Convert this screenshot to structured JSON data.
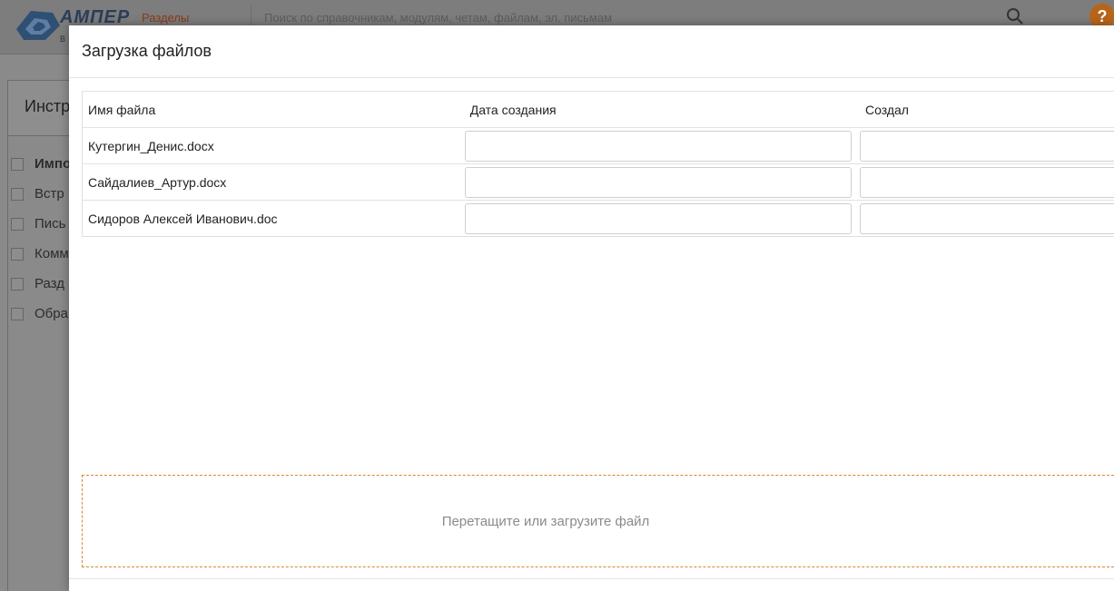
{
  "app": {
    "logo_text": "АМПЕР",
    "logo_sub": "В",
    "sections_label": "Разделы",
    "search_placeholder": "Поиск по справочникам, модулям, четам, файлам, эл. письмам",
    "help_label": "?"
  },
  "background": {
    "tools_label": "Инстр",
    "list_items": [
      {
        "label": "Импо"
      },
      {
        "label": "Встр"
      },
      {
        "label": "Пись"
      },
      {
        "label": "Комм"
      },
      {
        "label": "Разд"
      },
      {
        "label": "Обра"
      }
    ]
  },
  "modal": {
    "title": "Загрузка файлов",
    "table": {
      "headers": {
        "name": "Имя файла",
        "date": "Дата создания",
        "author": "Создал"
      },
      "rows": [
        {
          "name": "Кутергин_Денис.docx",
          "date": "",
          "author": ""
        },
        {
          "name": "Сайдалиев_Артур.docx",
          "date": "",
          "author": ""
        },
        {
          "name": "Сидоров Алексей Иванович.doc",
          "date": "",
          "author": ""
        }
      ]
    },
    "dropzone_label": "Перетащите или загрузите файл"
  },
  "colors": {
    "accent_dashed_border": "#d9882a",
    "help_icon_bg": "#b8651a"
  }
}
